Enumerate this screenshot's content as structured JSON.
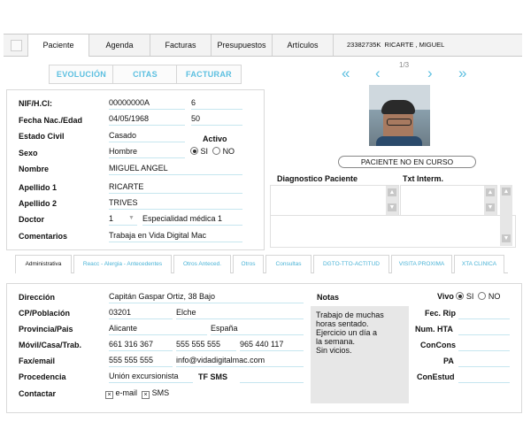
{
  "top_tabs": [
    "Paciente",
    "Agenda",
    "Facturas",
    "Presupuestos",
    "Artículos"
  ],
  "patient_header": {
    "id": "23382735K",
    "name": "RICARTE , MIGUEL"
  },
  "sections": [
    "EVOLUCIÓN",
    "CITAS",
    "FACTURAR"
  ],
  "nav": {
    "first": "«",
    "prev": "‹",
    "next": "›",
    "last": "»",
    "counter": "1/3"
  },
  "personal": {
    "nif_label": "NIF/H.Cl:",
    "nif": "00000000A",
    "hcl": "6",
    "birth_label": "Fecha Nac./Edad",
    "birth": "04/05/1968",
    "age": "50",
    "civil_label": "Estado Civil",
    "civil": "Casado",
    "active_label": "Activo",
    "sex_label": "Sexo",
    "sex": "Hombre",
    "active_yes": "SI",
    "active_no": "NO",
    "name_label": "Nombre",
    "name": "MIGUEL ANGEL",
    "surname1_label": "Apellido 1",
    "surname1": "RICARTE",
    "surname2_label": "Apellido 2",
    "surname2": "TRIVES",
    "doctor_label": "Doctor",
    "doctor_num": "1",
    "doctor": "Especialidad médica 1",
    "comments_label": "Comentarios",
    "comments": "Trabaja en Vida Digital Mac"
  },
  "status_button": "PACIENTE NO EN CURSO",
  "diagnosis": {
    "label": "Diagnostico Paciente",
    "interm_label": "Txt Interm."
  },
  "sub_tabs": [
    "Administrativa",
    "Reacc - Alergia - Antecedentes",
    "Otros Anteced.",
    "Otros",
    "Consultas",
    "DGTO-TTO-ACTITUD",
    "VISITA PROXIMA",
    "XTA CLINICA"
  ],
  "admin": {
    "address_label": "Dirección",
    "address": "Capitán Gaspar Ortiz, 38 Bajo",
    "cp_label": "CP/Población",
    "cp": "03201",
    "city": "Elche",
    "province_label": "Provincia/Pais",
    "province": "Alicante",
    "country": "España",
    "phones_label": "Móvil/Casa/Trab.",
    "mobile": "661 316 367",
    "home": "555 555 555",
    "work": "965 440 117",
    "fax_label": "Fax/email",
    "fax": "555 555 555",
    "email": "info@vidadigitalmac.com",
    "origin_label": "Procedencia",
    "origin": "Unión excursionista",
    "tf_sms_label": "TF SMS",
    "contact_label": "Contactar",
    "contact_email": "e-mail",
    "contact_sms": "SMS",
    "notes_label": "Notas",
    "notes": "Trabajo de muchas\nhoras sentado.\nEjercicio un día a\nla semana.\nSin vicios.",
    "vivo_label": "Vivo",
    "vivo_yes": "SI",
    "vivo_no": "NO",
    "fec_rip_label": "Fec. Rip",
    "num_hta_label": "Num. HTA",
    "concons_label": "ConCons",
    "pa_label": "PA",
    "conestud_label": "ConEstud"
  },
  "colors": {
    "accent": "#5bbfe0",
    "field_line": "#c6e6ef"
  }
}
